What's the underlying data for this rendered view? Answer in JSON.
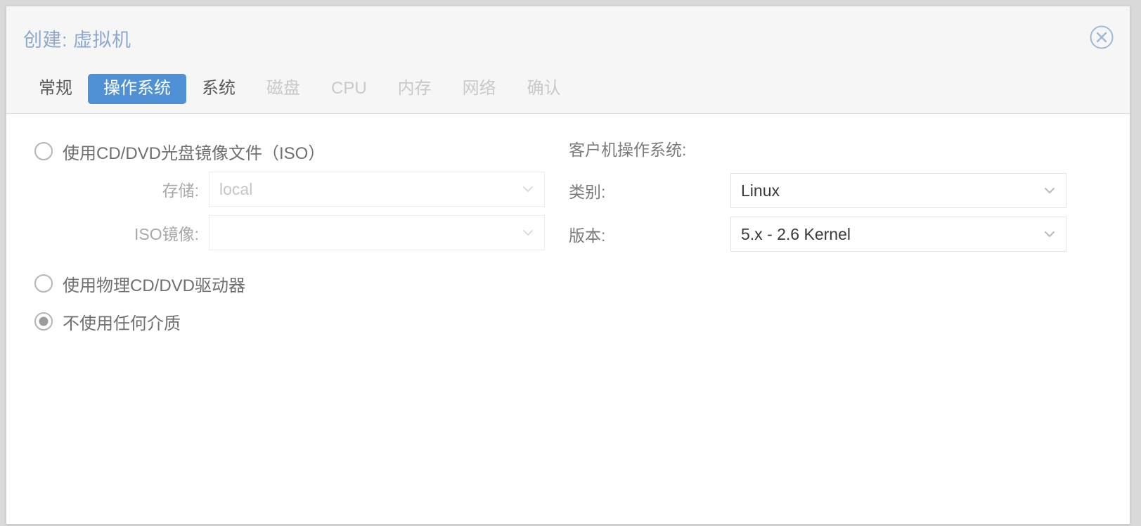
{
  "dialog": {
    "title": "创建: 虚拟机",
    "close_icon": "close-circle-icon"
  },
  "tabs": [
    {
      "label": "常规",
      "state": "normal"
    },
    {
      "label": "操作系统",
      "state": "active"
    },
    {
      "label": "系统",
      "state": "normal"
    },
    {
      "label": "磁盘",
      "state": "disabled"
    },
    {
      "label": "CPU",
      "state": "disabled"
    },
    {
      "label": "内存",
      "state": "disabled"
    },
    {
      "label": "网络",
      "state": "disabled"
    },
    {
      "label": "确认",
      "state": "disabled"
    }
  ],
  "media": {
    "options": [
      {
        "label": "使用CD/DVD光盘镜像文件（ISO）",
        "selected": false
      },
      {
        "label": "使用物理CD/DVD驱动器",
        "selected": false
      },
      {
        "label": "不使用任何介质",
        "selected": true
      }
    ],
    "storage": {
      "label": "存储:",
      "value": "local",
      "chevron": "chevron-down-icon"
    },
    "iso_image": {
      "label": "ISO镜像:",
      "value": "",
      "chevron": "chevron-down-icon"
    }
  },
  "guest_os": {
    "section_label": "客户机操作系统:",
    "type": {
      "label": "类别:",
      "value": "Linux",
      "chevron": "chevron-down-icon"
    },
    "version": {
      "label": "版本:",
      "value": "5.x - 2.6 Kernel",
      "chevron": "chevron-down-icon"
    }
  },
  "colors": {
    "accent": "#4f91d4",
    "title": "#8ea9cf",
    "header_bg": "#f6f6f6",
    "body_bg": "#ffffff",
    "border": "#e2e2e2"
  }
}
